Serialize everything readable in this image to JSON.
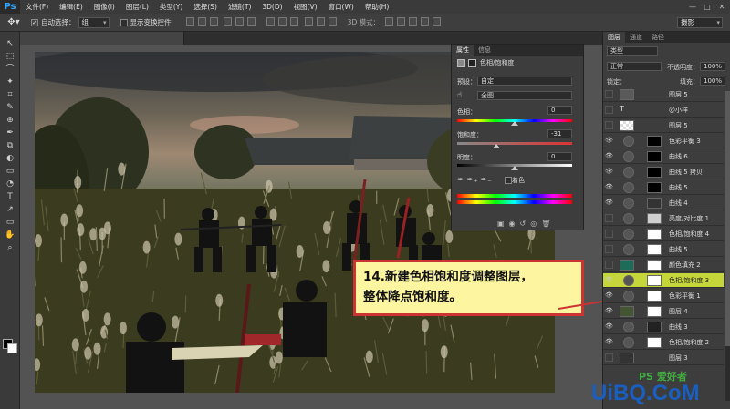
{
  "app": {
    "logo": "Ps"
  },
  "menu": [
    "文件(F)",
    "编辑(E)",
    "图像(I)",
    "图层(L)",
    "类型(Y)",
    "选择(S)",
    "滤镜(T)",
    "3D(D)",
    "视图(V)",
    "窗口(W)",
    "帮助(H)"
  ],
  "window_controls": [
    "—",
    "□",
    "✕"
  ],
  "options": {
    "auto_select_label": "自动选择：",
    "auto_select_value": "组",
    "show_transform_label": "显示变换控件",
    "mode_3d_label": "3D 模式：",
    "workspace_value": "摄影"
  },
  "tools": [
    "↖",
    "⬚",
    "⌒",
    "✦",
    "⌗",
    "✎",
    "⊕",
    "✒",
    "⧉",
    "◐",
    "▭",
    "◔",
    "T",
    "↗",
    "▭",
    "✋",
    "⌕"
  ],
  "properties": {
    "tabs": [
      "属性",
      "信息"
    ],
    "header": "色相/饱和度",
    "preset_label": "预设：",
    "preset_value": "自定",
    "channel_value": "全图",
    "hue_label": "色相：",
    "hue_value": "0",
    "saturation_label": "饱和度：",
    "saturation_value": "-31",
    "lightness_label": "明度：",
    "lightness_value": "0",
    "colorize_label": "着色",
    "hue_position": 0.5,
    "saturation_position": 0.345,
    "lightness_position": 0.5
  },
  "callout": {
    "line1": "14.新建色相饱和度调整图层，",
    "line2": "整体降点饱和度。"
  },
  "layers_panel": {
    "tabs": [
      "图层",
      "通道",
      "路径"
    ],
    "kind_filter": "类型",
    "blend_mode": "正常",
    "opacity_label": "不透明度：",
    "opacity_value": "100%",
    "lock_label": "锁定：",
    "fill_label": "填充：",
    "fill_value": "100%",
    "layers": [
      {
        "name": "图层 5",
        "thumb": "#5a5a5a",
        "mask": null,
        "visible": false,
        "selected": false
      },
      {
        "name": "@小祥",
        "thumb": "text",
        "mask": null,
        "visible": false,
        "selected": false
      },
      {
        "name": "图层 5",
        "thumb": "checker",
        "mask": null,
        "visible": false,
        "selected": false
      },
      {
        "name": "色彩平衡 3",
        "thumb": "adj",
        "mask": "#000000",
        "visible": true,
        "selected": false
      },
      {
        "name": "曲线 6",
        "thumb": "adj",
        "mask": "#000000",
        "visible": true,
        "selected": false
      },
      {
        "name": "曲线 5 拷贝",
        "thumb": "adj",
        "mask": "#000000",
        "visible": true,
        "selected": false
      },
      {
        "name": "曲线 5",
        "thumb": "adj",
        "mask": "#000000",
        "visible": true,
        "selected": false
      },
      {
        "name": "曲线 4",
        "thumb": "adj",
        "mask": "#333333",
        "visible": true,
        "selected": false
      },
      {
        "name": "亮度/对比度 1",
        "thumb": "adj",
        "mask": "#cfcfcf",
        "visible": false,
        "selected": false
      },
      {
        "name": "色相/饱和度 4",
        "thumb": "adj",
        "mask": "#ffffff",
        "visible": false,
        "selected": false
      },
      {
        "name": "曲线 5",
        "thumb": "adj",
        "mask": "#ffffff",
        "visible": false,
        "selected": false
      },
      {
        "name": "颜色填充 2",
        "thumb": "#1f6b5a",
        "mask": "#ffffff",
        "visible": false,
        "selected": false
      },
      {
        "name": "色相/饱和度 3",
        "thumb": "adj",
        "mask": "#ffffff",
        "visible": true,
        "selected": true
      },
      {
        "name": "色彩平衡 1",
        "thumb": "adj",
        "mask": "#ffffff",
        "visible": true,
        "selected": false
      },
      {
        "name": "图层 4",
        "thumb": "#445533",
        "mask": "#ffffff",
        "visible": true,
        "selected": false
      },
      {
        "name": "曲线 3",
        "thumb": "adj",
        "mask": "#222222",
        "visible": true,
        "selected": false
      },
      {
        "name": "色相/饱和度 2",
        "thumb": "adj",
        "mask": "#ffffff",
        "visible": true,
        "selected": false
      },
      {
        "name": "图层 3",
        "thumb": "#333333",
        "mask": null,
        "visible": false,
        "selected": false
      }
    ]
  },
  "watermark": {
    "text1": "PS 爱好者",
    "text2": "UiBQ.CoM"
  }
}
